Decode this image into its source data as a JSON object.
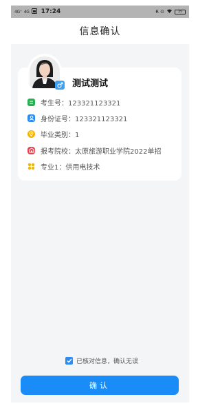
{
  "status_bar": {
    "signal_1": "4G⁺",
    "signal_2": "4G",
    "time": "17:24",
    "right_text": "₭ ⊙ ",
    "battery": "35"
  },
  "header": {
    "title": "信息确认"
  },
  "profile": {
    "name": "测试测试",
    "gender_icon": "male-icon",
    "fields": [
      {
        "label": "考生号：123321123321",
        "icon": "id-card-icon",
        "color": "#22b14c"
      },
      {
        "label": "身份证号：123321123321",
        "icon": "person-icon",
        "color": "#2d8cf0"
      },
      {
        "label": "毕业类别：1",
        "icon": "location-pin-icon",
        "color": "#f5b400"
      },
      {
        "label": "报考院校：太原旅游职业学院2022单招",
        "icon": "school-icon",
        "color": "#e8424f"
      },
      {
        "label": "专业1：供用电技术",
        "icon": "grid-icon",
        "color": "#f5b400"
      }
    ]
  },
  "agreement": {
    "checked": true,
    "label": "已核对信息，确认无误"
  },
  "confirm_button": {
    "label": "确认"
  },
  "colors": {
    "accent": "#1a8cf7",
    "background": "#f3f5f7"
  }
}
